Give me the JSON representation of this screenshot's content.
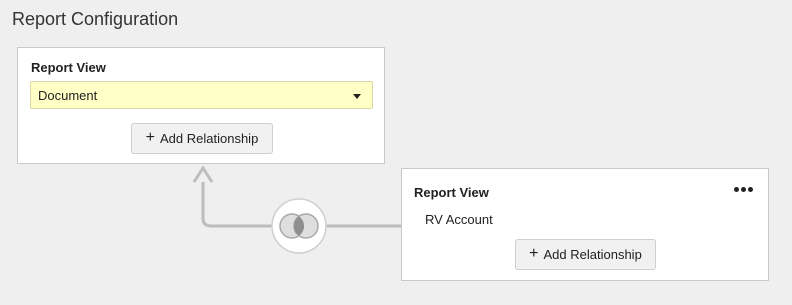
{
  "page": {
    "title": "Report Configuration"
  },
  "primary_view": {
    "label": "Report View",
    "select": {
      "value": "Document"
    },
    "add_relationship_label": "Add Relationship"
  },
  "joined_view": {
    "label": "Report View",
    "value": "RV Account",
    "add_relationship_label": "Add Relationship"
  },
  "icons": {
    "join": "join-venn-icon",
    "more": "more-options-icon",
    "add": "plus-icon",
    "dropdown": "caret-down-icon",
    "arrow": "arrow-up-icon"
  }
}
